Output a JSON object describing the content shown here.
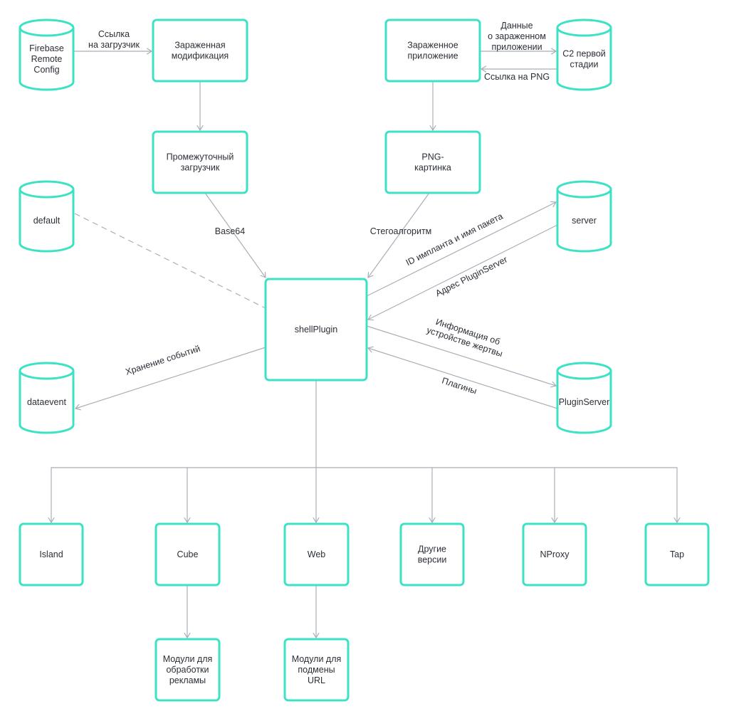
{
  "colors": {
    "node_stroke": "#3de2c4",
    "edge": "#a9afb8",
    "text": "#2b2f36"
  },
  "nodes": {
    "firebase": {
      "shape": "cylinder",
      "lines": [
        "Firebase",
        "Remote",
        "Config"
      ]
    },
    "infected_mod": {
      "shape": "box",
      "lines": [
        "Зараженная",
        "модификация"
      ]
    },
    "infected_app": {
      "shape": "box",
      "lines": [
        "Зараженное",
        "приложение"
      ]
    },
    "c2_first": {
      "shape": "cylinder",
      "lines": [
        "C2 первой",
        "стадии"
      ]
    },
    "intermediate_loader": {
      "shape": "box",
      "lines": [
        "Промежуточный",
        "загрузчик"
      ]
    },
    "png_image": {
      "shape": "box",
      "lines": [
        "PNG-",
        "картинка"
      ]
    },
    "default": {
      "shape": "cylinder",
      "lines": [
        "default"
      ]
    },
    "server": {
      "shape": "cylinder",
      "lines": [
        "server"
      ]
    },
    "shellplugin": {
      "shape": "box",
      "lines": [
        "shellPlugin"
      ]
    },
    "dataevent": {
      "shape": "cylinder",
      "lines": [
        "dataevent"
      ]
    },
    "pluginserver": {
      "shape": "cylinder",
      "lines": [
        "PluginServer"
      ]
    },
    "island": {
      "shape": "box",
      "lines": [
        "Island"
      ]
    },
    "cube": {
      "shape": "box",
      "lines": [
        "Cube"
      ]
    },
    "web": {
      "shape": "box",
      "lines": [
        "Web"
      ]
    },
    "other_versions": {
      "shape": "box",
      "lines": [
        "Другие",
        "версии"
      ]
    },
    "nproxy": {
      "shape": "box",
      "lines": [
        "NProxy"
      ]
    },
    "tap": {
      "shape": "box",
      "lines": [
        "Tap"
      ]
    },
    "ad_modules": {
      "shape": "box",
      "lines": [
        "Модули для",
        "обработки",
        "рекламы"
      ]
    },
    "url_modules": {
      "shape": "box",
      "lines": [
        "Модули для",
        "подмены",
        "URL"
      ]
    }
  },
  "edges": [
    {
      "from": "firebase",
      "to": "infected_mod",
      "label": [
        "Ссылка",
        "на загрузчик"
      ]
    },
    {
      "from": "infected_mod",
      "to": "intermediate_loader",
      "label": []
    },
    {
      "from": "infected_app",
      "to": "c2_first",
      "label": [
        "Данные",
        "о зараженном",
        "приложении"
      ]
    },
    {
      "from": "c2_first",
      "to": "infected_app",
      "label": [
        "Ссылка на PNG"
      ]
    },
    {
      "from": "infected_app",
      "to": "png_image",
      "label": []
    },
    {
      "from": "intermediate_loader",
      "to": "shellplugin",
      "label": [
        "Base64"
      ]
    },
    {
      "from": "png_image",
      "to": "shellplugin",
      "label": [
        "Стегоалгоритм"
      ]
    },
    {
      "from": "default",
      "to": "shellplugin",
      "label": [],
      "style": "dashed"
    },
    {
      "from": "shellplugin",
      "to": "server",
      "label": [
        "ID импланта и имя пакета"
      ]
    },
    {
      "from": "server",
      "to": "shellplugin",
      "label": [
        "Адрес PluginServer"
      ]
    },
    {
      "from": "shellplugin",
      "to": "pluginserver",
      "label": [
        "Информация об",
        "устройстве жертвы"
      ]
    },
    {
      "from": "pluginserver",
      "to": "shellplugin",
      "label": [
        "Плагины"
      ]
    },
    {
      "from": "shellplugin",
      "to": "dataevent",
      "label": [
        "Хранение событий"
      ]
    },
    {
      "from": "shellplugin",
      "to": "island",
      "label": []
    },
    {
      "from": "shellplugin",
      "to": "cube",
      "label": []
    },
    {
      "from": "shellplugin",
      "to": "web",
      "label": []
    },
    {
      "from": "shellplugin",
      "to": "other_versions",
      "label": []
    },
    {
      "from": "shellplugin",
      "to": "nproxy",
      "label": []
    },
    {
      "from": "shellplugin",
      "to": "tap",
      "label": []
    },
    {
      "from": "cube",
      "to": "ad_modules",
      "label": []
    },
    {
      "from": "web",
      "to": "url_modules",
      "label": []
    }
  ]
}
